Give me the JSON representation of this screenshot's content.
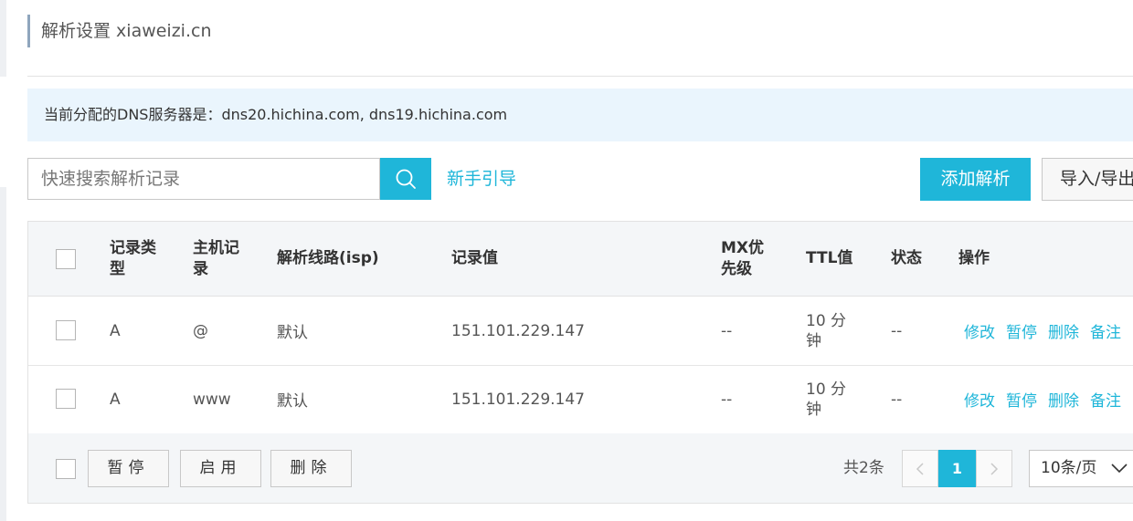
{
  "header": {
    "title": "解析设置 xiaweizi.cn"
  },
  "notice": {
    "text": "当前分配的DNS服务器是：dns20.hichina.com, dns19.hichina.com"
  },
  "toolbar": {
    "search_placeholder": "快速搜索解析记录",
    "search_icon": "search-icon",
    "guide_link": "新手引导",
    "add_button": "添加解析",
    "import_export_button": "导入/导出"
  },
  "table": {
    "columns": {
      "type": "记录类型",
      "host": "主机记录",
      "line": "解析线路(isp)",
      "value": "记录值",
      "mx": "MX优先级",
      "ttl": "TTL值",
      "status": "状态",
      "actions": "操作"
    },
    "rows": [
      {
        "type": "A",
        "host": "@",
        "line": "默认",
        "value": "151.101.229.147",
        "mx": "--",
        "ttl": "10 分钟",
        "status": "--"
      },
      {
        "type": "A",
        "host": "www",
        "line": "默认",
        "value": "151.101.229.147",
        "mx": "--",
        "ttl": "10 分钟",
        "status": "--"
      }
    ],
    "row_actions": [
      "修改",
      "暂停",
      "删除",
      "备注"
    ]
  },
  "footer": {
    "buttons": [
      "暂停",
      "启用",
      "删除"
    ],
    "total": "共2条",
    "current_page": "1",
    "page_size": "10条/页"
  },
  "colors": {
    "accent": "#1fb6d9",
    "notice_bg": "#eaf5fd",
    "table_header_bg": "#f4f6f8"
  }
}
